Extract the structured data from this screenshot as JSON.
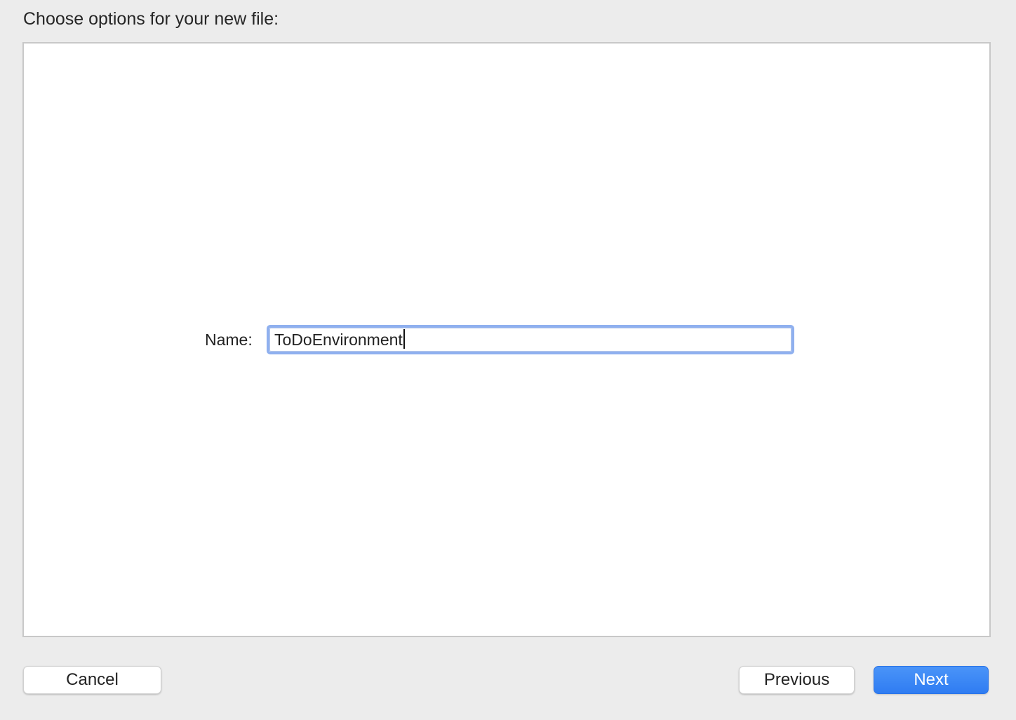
{
  "dialog": {
    "heading": "Choose options for your new file:"
  },
  "form": {
    "name_label": "Name:",
    "name_value": "ToDoEnvironment"
  },
  "buttons": {
    "cancel": "Cancel",
    "previous": "Previous",
    "next": "Next"
  },
  "colors": {
    "window_background": "#ececec",
    "panel_background": "#ffffff",
    "focus_ring": "#8fb0ef",
    "primary_button": "#3784f5"
  }
}
